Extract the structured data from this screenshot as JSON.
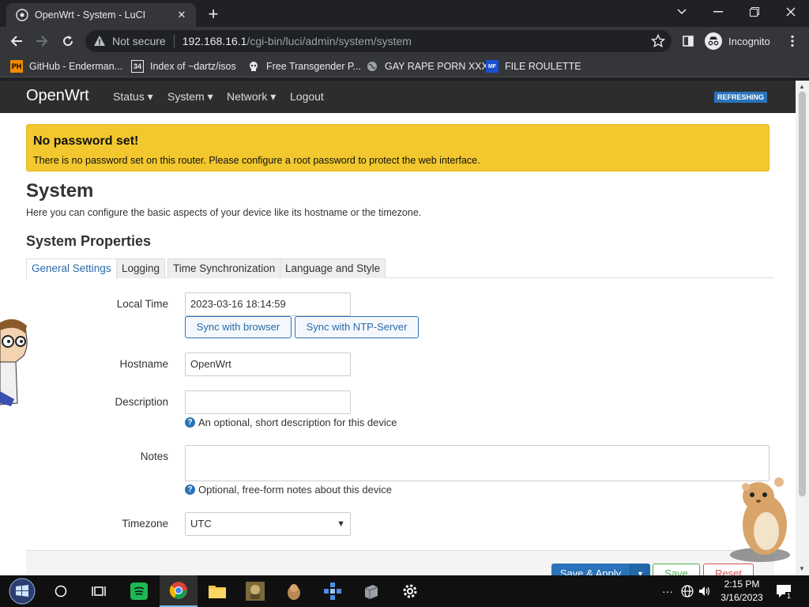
{
  "browser": {
    "tab_title": "OpenWrt - System - LuCI",
    "new_tab": "+",
    "url_not_secure": "Not secure",
    "url_host": "192.168.16.1",
    "url_path": "/cgi-bin/luci/admin/system/system",
    "profile_label": "Incognito",
    "bookmarks": [
      {
        "label": "GitHub - Enderman...",
        "icon": "PH"
      },
      {
        "label": "Index of ~dartz/isos",
        "icon": "34"
      },
      {
        "label": "Free Transgender P...",
        "icon": "skull"
      },
      {
        "label": "GAY RAPE PORN XXX",
        "icon": "globe"
      },
      {
        "label": "FILE ROULETTE",
        "icon": "MF"
      }
    ]
  },
  "luci": {
    "brand": "OpenWrt",
    "menu": [
      "Status",
      "System",
      "Network",
      "Logout"
    ],
    "refreshing": "REFRESHING",
    "alert_title": "No password set!",
    "alert_text": "There is no password set on this router. Please configure a root password to protect the web interface.",
    "page_title": "System",
    "page_desc": "Here you can configure the basic aspects of your device like its hostname or the timezone.",
    "section_title": "System Properties",
    "tabs": [
      "General Settings",
      "Logging",
      "Time Synchronization",
      "Language and Style"
    ],
    "fields": {
      "local_time_label": "Local Time",
      "local_time_value": "2023-03-16 18:14:59",
      "sync_browser": "Sync with browser",
      "sync_ntp": "Sync with NTP-Server",
      "hostname_label": "Hostname",
      "hostname_value": "OpenWrt",
      "description_label": "Description",
      "description_value": "",
      "description_help": "An optional, short description for this device",
      "notes_label": "Notes",
      "notes_value": "",
      "notes_help": "Optional, free-form notes about this device",
      "timezone_label": "Timezone",
      "timezone_value": "UTC"
    },
    "buttons": {
      "save_apply": "Save & Apply",
      "save": "Save",
      "reset": "Reset"
    }
  },
  "taskbar": {
    "time": "2:15 PM",
    "date": "3/16/2023",
    "notifications": "1"
  },
  "colors": {
    "alert_bg": "#f2c82e",
    "luci_blue": "#2a73ba",
    "header_bg": "#2d2d2d"
  }
}
